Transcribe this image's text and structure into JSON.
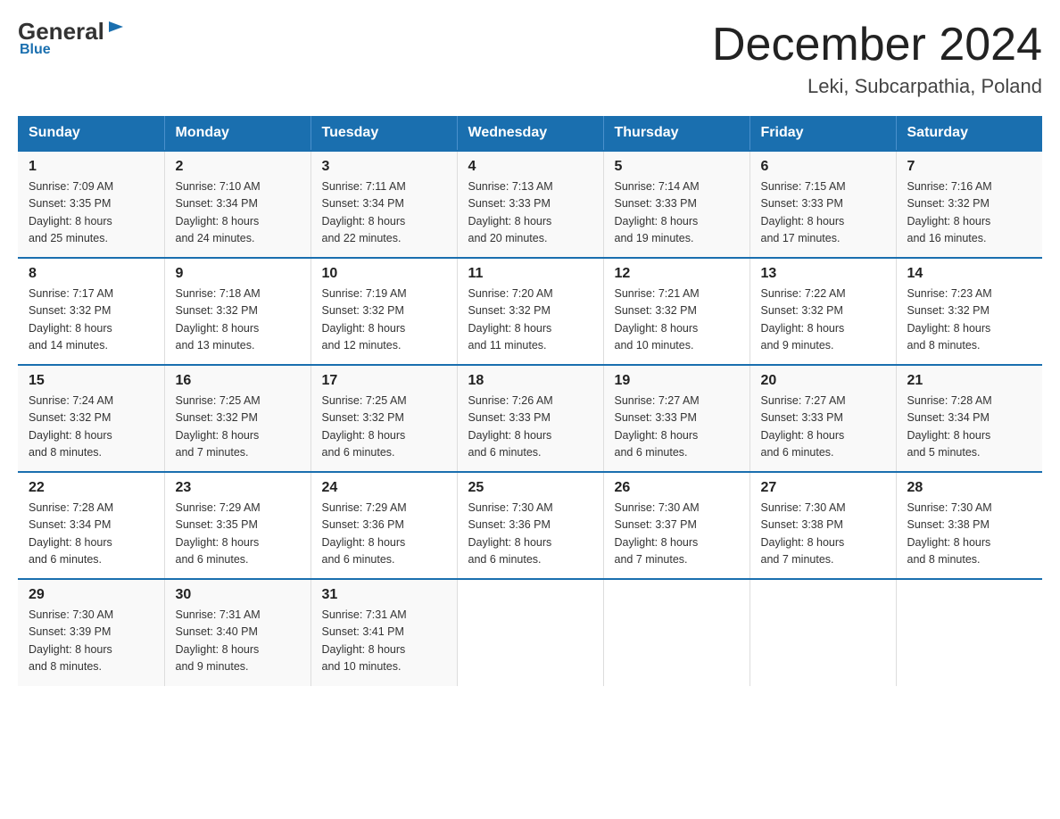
{
  "header": {
    "logo": {
      "general": "General",
      "blue": "Blue"
    },
    "title": "December 2024",
    "location": "Leki, Subcarpathia, Poland"
  },
  "weekdays": [
    "Sunday",
    "Monday",
    "Tuesday",
    "Wednesday",
    "Thursday",
    "Friday",
    "Saturday"
  ],
  "weeks": [
    [
      {
        "day": 1,
        "sunrise": "7:09 AM",
        "sunset": "3:35 PM",
        "daylight": "8 hours and 25 minutes."
      },
      {
        "day": 2,
        "sunrise": "7:10 AM",
        "sunset": "3:34 PM",
        "daylight": "8 hours and 24 minutes."
      },
      {
        "day": 3,
        "sunrise": "7:11 AM",
        "sunset": "3:34 PM",
        "daylight": "8 hours and 22 minutes."
      },
      {
        "day": 4,
        "sunrise": "7:13 AM",
        "sunset": "3:33 PM",
        "daylight": "8 hours and 20 minutes."
      },
      {
        "day": 5,
        "sunrise": "7:14 AM",
        "sunset": "3:33 PM",
        "daylight": "8 hours and 19 minutes."
      },
      {
        "day": 6,
        "sunrise": "7:15 AM",
        "sunset": "3:33 PM",
        "daylight": "8 hours and 17 minutes."
      },
      {
        "day": 7,
        "sunrise": "7:16 AM",
        "sunset": "3:32 PM",
        "daylight": "8 hours and 16 minutes."
      }
    ],
    [
      {
        "day": 8,
        "sunrise": "7:17 AM",
        "sunset": "3:32 PM",
        "daylight": "8 hours and 14 minutes."
      },
      {
        "day": 9,
        "sunrise": "7:18 AM",
        "sunset": "3:32 PM",
        "daylight": "8 hours and 13 minutes."
      },
      {
        "day": 10,
        "sunrise": "7:19 AM",
        "sunset": "3:32 PM",
        "daylight": "8 hours and 12 minutes."
      },
      {
        "day": 11,
        "sunrise": "7:20 AM",
        "sunset": "3:32 PM",
        "daylight": "8 hours and 11 minutes."
      },
      {
        "day": 12,
        "sunrise": "7:21 AM",
        "sunset": "3:32 PM",
        "daylight": "8 hours and 10 minutes."
      },
      {
        "day": 13,
        "sunrise": "7:22 AM",
        "sunset": "3:32 PM",
        "daylight": "8 hours and 9 minutes."
      },
      {
        "day": 14,
        "sunrise": "7:23 AM",
        "sunset": "3:32 PM",
        "daylight": "8 hours and 8 minutes."
      }
    ],
    [
      {
        "day": 15,
        "sunrise": "7:24 AM",
        "sunset": "3:32 PM",
        "daylight": "8 hours and 8 minutes."
      },
      {
        "day": 16,
        "sunrise": "7:25 AM",
        "sunset": "3:32 PM",
        "daylight": "8 hours and 7 minutes."
      },
      {
        "day": 17,
        "sunrise": "7:25 AM",
        "sunset": "3:32 PM",
        "daylight": "8 hours and 6 minutes."
      },
      {
        "day": 18,
        "sunrise": "7:26 AM",
        "sunset": "3:33 PM",
        "daylight": "8 hours and 6 minutes."
      },
      {
        "day": 19,
        "sunrise": "7:27 AM",
        "sunset": "3:33 PM",
        "daylight": "8 hours and 6 minutes."
      },
      {
        "day": 20,
        "sunrise": "7:27 AM",
        "sunset": "3:33 PM",
        "daylight": "8 hours and 6 minutes."
      },
      {
        "day": 21,
        "sunrise": "7:28 AM",
        "sunset": "3:34 PM",
        "daylight": "8 hours and 5 minutes."
      }
    ],
    [
      {
        "day": 22,
        "sunrise": "7:28 AM",
        "sunset": "3:34 PM",
        "daylight": "8 hours and 6 minutes."
      },
      {
        "day": 23,
        "sunrise": "7:29 AM",
        "sunset": "3:35 PM",
        "daylight": "8 hours and 6 minutes."
      },
      {
        "day": 24,
        "sunrise": "7:29 AM",
        "sunset": "3:36 PM",
        "daylight": "8 hours and 6 minutes."
      },
      {
        "day": 25,
        "sunrise": "7:30 AM",
        "sunset": "3:36 PM",
        "daylight": "8 hours and 6 minutes."
      },
      {
        "day": 26,
        "sunrise": "7:30 AM",
        "sunset": "3:37 PM",
        "daylight": "8 hours and 7 minutes."
      },
      {
        "day": 27,
        "sunrise": "7:30 AM",
        "sunset": "3:38 PM",
        "daylight": "8 hours and 7 minutes."
      },
      {
        "day": 28,
        "sunrise": "7:30 AM",
        "sunset": "3:38 PM",
        "daylight": "8 hours and 8 minutes."
      }
    ],
    [
      {
        "day": 29,
        "sunrise": "7:30 AM",
        "sunset": "3:39 PM",
        "daylight": "8 hours and 8 minutes."
      },
      {
        "day": 30,
        "sunrise": "7:31 AM",
        "sunset": "3:40 PM",
        "daylight": "8 hours and 9 minutes."
      },
      {
        "day": 31,
        "sunrise": "7:31 AM",
        "sunset": "3:41 PM",
        "daylight": "8 hours and 10 minutes."
      },
      null,
      null,
      null,
      null
    ]
  ],
  "labels": {
    "sunrise": "Sunrise:",
    "sunset": "Sunset:",
    "daylight": "Daylight:"
  }
}
